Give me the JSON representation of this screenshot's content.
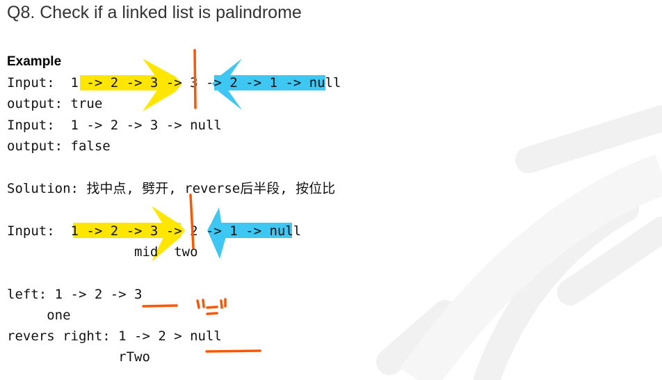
{
  "title": "Q8.  Check if a linked list is palindrome",
  "example_heading": "Example",
  "lines": {
    "input1": "Input:  1 -> 2 -> 3 -> 3 -> 2 -> 1 -> null",
    "output1": "output: true",
    "input2": "Input:  1 -> 2 -> 3 -> null",
    "output2": "output: false",
    "solution": "Solution: 找中点, 劈开, reverse后半段, 按位比",
    "input3": "Input:  1 -> 2 -> 3 -> 2 -> 1 -> null",
    "input3_labels": "                mid  two",
    "left": "left: 1 -> 2 -> 3",
    "left_label": "     one",
    "right": "revers right: 1 -> 2 > null",
    "right_label": "              rTwo"
  },
  "annotation_colors": {
    "highlighter_yellow": "#FFE600",
    "highlighter_blue": "#3EC7F2",
    "pen_orange": "#FF5500"
  }
}
